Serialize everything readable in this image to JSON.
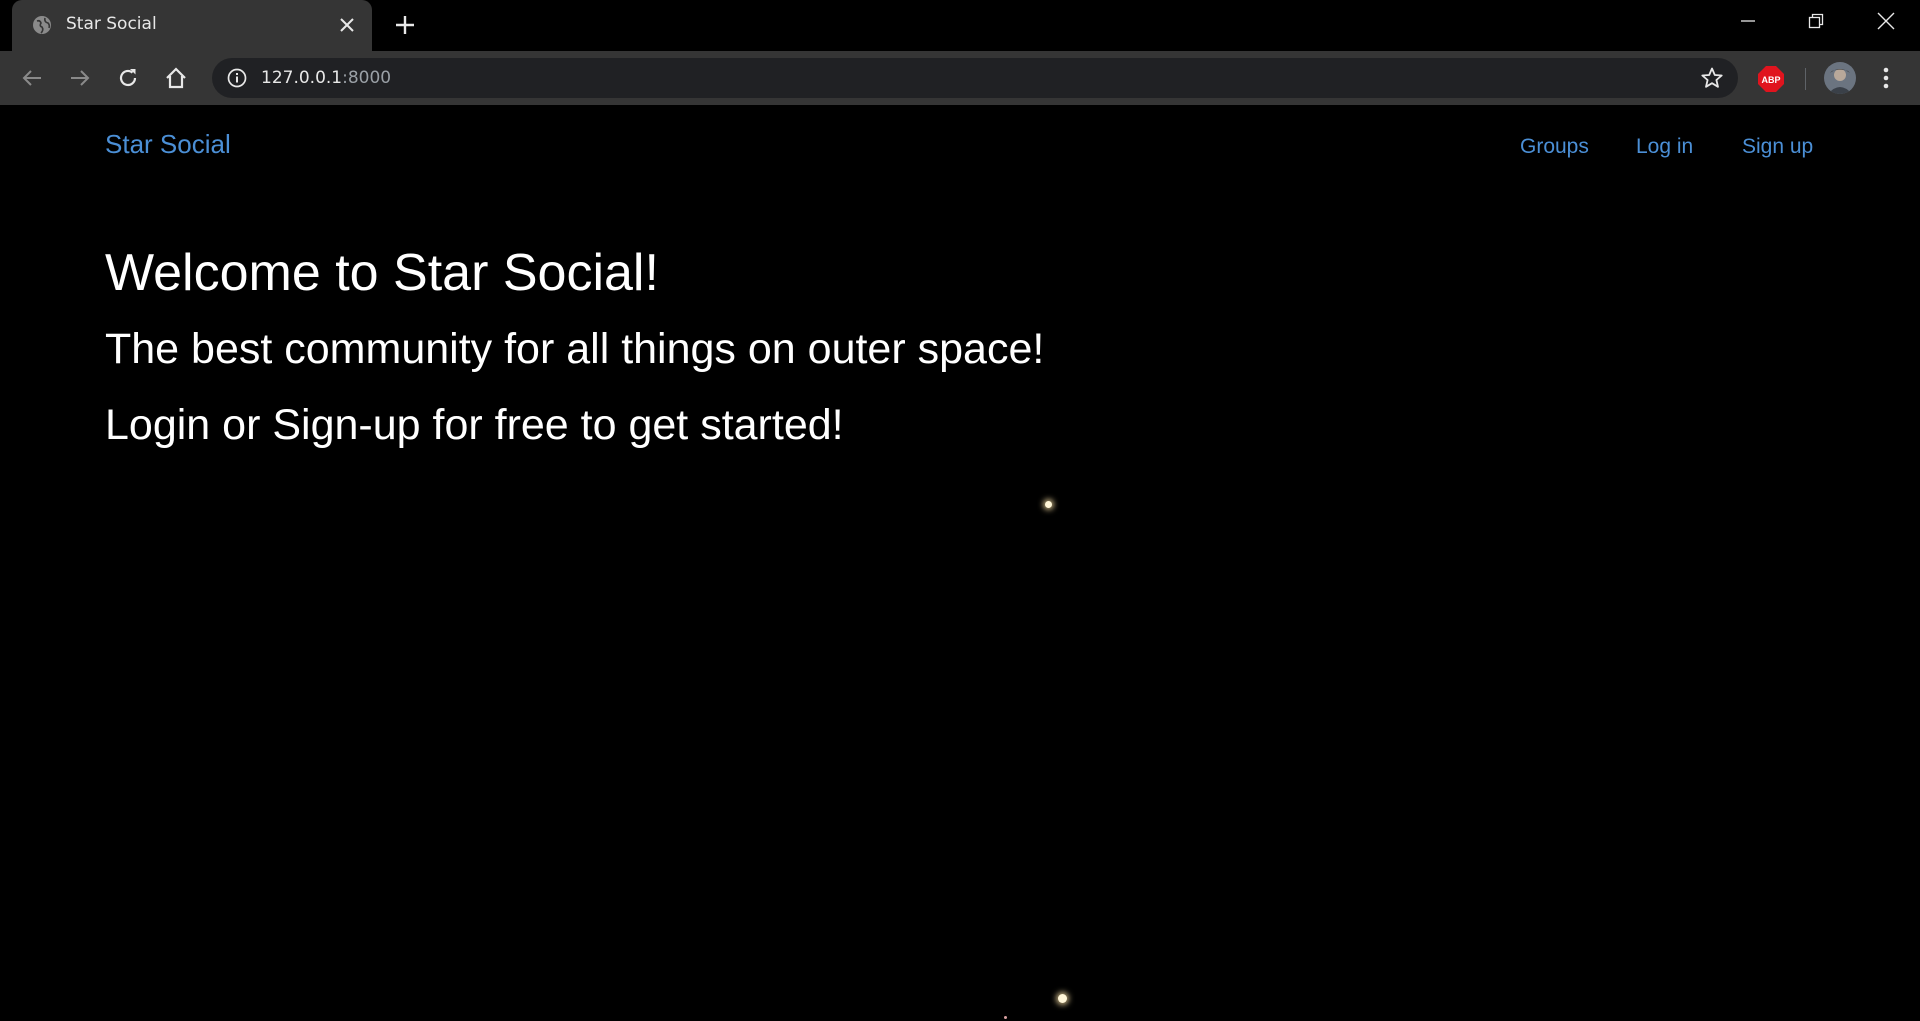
{
  "browser": {
    "tab": {
      "title": "Star Social",
      "favicon": "globe-icon",
      "close_icon": "close-icon"
    },
    "new_tab_icon": "plus-icon",
    "window_controls": [
      "minimize-icon",
      "restore-icon",
      "close-icon"
    ],
    "toolbar": {
      "back_icon": "arrow-left-icon",
      "forward_icon": "arrow-right-icon",
      "reload_icon": "reload-icon",
      "home_icon": "home-icon",
      "address": {
        "host": "127.0.0.1",
        "port": ":8000",
        "info_icon": "info-icon",
        "bookmark_icon": "star-outline-icon"
      },
      "extension_label": "ABP",
      "extension_color": "#e0141e",
      "menu_icon": "kebab-menu-icon"
    }
  },
  "site": {
    "brand": "Star Social",
    "nav": {
      "groups": "Groups",
      "login": "Log in",
      "signup": "Sign up"
    },
    "hero": {
      "title": "Welcome to Star Social!",
      "subtitle": "The best community for all things on outer space!",
      "cta": "Login or Sign-up for free to get started!"
    }
  },
  "colors": {
    "link": "#4b8fd6",
    "background": "#000000",
    "text": "#ffffff",
    "chrome": "#353535"
  }
}
